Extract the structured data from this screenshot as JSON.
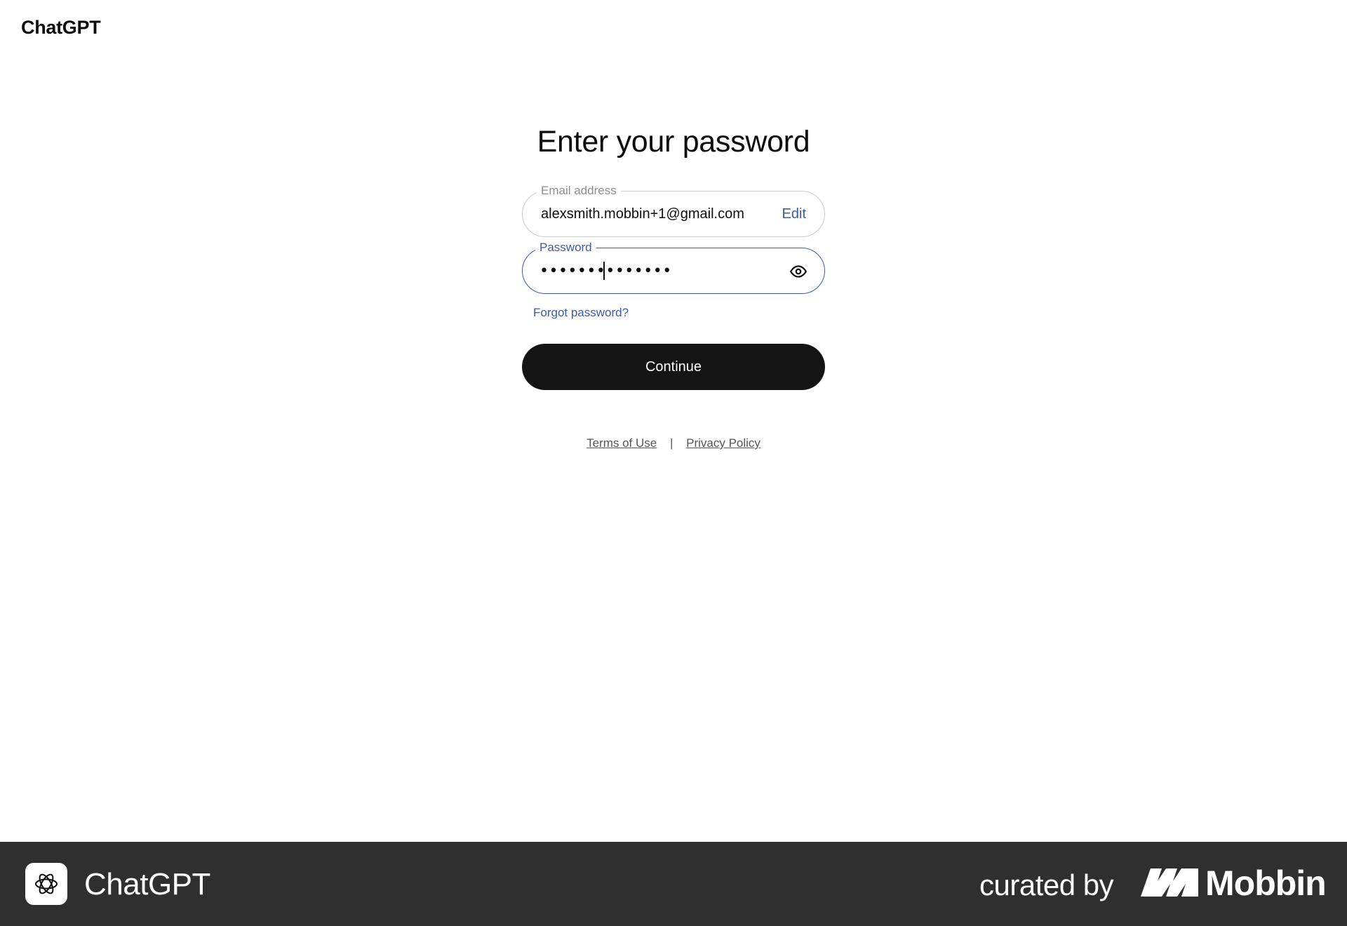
{
  "header": {
    "brand": "ChatGPT"
  },
  "main": {
    "title": "Enter your password",
    "email_field": {
      "label": "Email address",
      "value": "alexsmith.mobbin+1@gmail.com",
      "edit_label": "Edit"
    },
    "password_field": {
      "label": "Password",
      "masked_value": "••••••••••••••",
      "toggle_icon": "eye-icon"
    },
    "forgot_password": "Forgot password?",
    "continue_label": "Continue",
    "legal": {
      "terms": "Terms of Use",
      "separator": "|",
      "privacy": "Privacy Policy"
    }
  },
  "footer": {
    "app_icon": "openai-logo-icon",
    "app_name": "ChatGPT",
    "curated_by": "curated by",
    "curator": "Mobbin",
    "curator_icon": "mobbin-logo-icon"
  },
  "colors": {
    "accent": "#3c5aa6",
    "button": "#141414",
    "footer_bg": "#2f2f2f"
  }
}
